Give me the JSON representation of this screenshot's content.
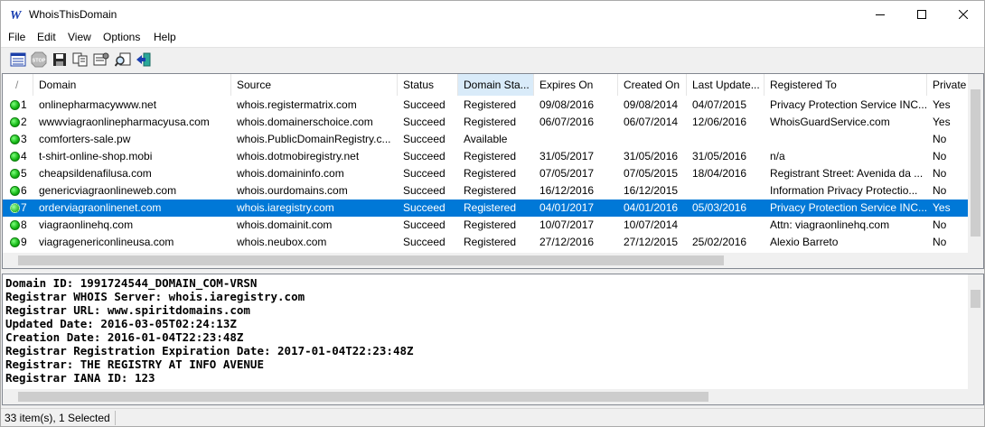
{
  "window": {
    "title": "WhoisThisDomain"
  },
  "menu": [
    {
      "label": "File"
    },
    {
      "label": "Edit"
    },
    {
      "label": "View"
    },
    {
      "label": "Options"
    },
    {
      "label": "Help"
    }
  ],
  "toolbar": [
    {
      "icon": "properties-list-icon"
    },
    {
      "icon": "stop-icon",
      "label": "STOP"
    },
    {
      "icon": "save-icon"
    },
    {
      "icon": "copy-icon"
    },
    {
      "icon": "html-report-icon"
    },
    {
      "icon": "search-icon"
    },
    {
      "icon": "exit-icon"
    }
  ],
  "columns": [
    {
      "label": "/"
    },
    {
      "label": "Domain"
    },
    {
      "label": "Source"
    },
    {
      "label": "Status"
    },
    {
      "label": "Domain Sta..."
    },
    {
      "label": "Expires On"
    },
    {
      "label": "Created On"
    },
    {
      "label": "Last Update..."
    },
    {
      "label": "Registered To"
    },
    {
      "label": "Private I"
    }
  ],
  "rows": [
    {
      "num": "1",
      "domain": "onlinepharmacywww.net",
      "source": "whois.registermatrix.com",
      "status": "Succeed",
      "domain_status": "Registered",
      "expires": "09/08/2016",
      "created": "09/08/2014",
      "updated": "04/07/2015",
      "registered_to": "Privacy Protection Service INC...",
      "private": "Yes"
    },
    {
      "num": "2",
      "domain": "wwwviagraonlinepharmacyusa.com",
      "source": "whois.domainerschoice.com",
      "status": "Succeed",
      "domain_status": "Registered",
      "expires": "06/07/2016",
      "created": "06/07/2014",
      "updated": "12/06/2016",
      "registered_to": "WhoisGuardService.com",
      "private": "Yes"
    },
    {
      "num": "3",
      "domain": "comforters-sale.pw",
      "source": "whois.PublicDomainRegistry.c...",
      "status": "Succeed",
      "domain_status": "Available",
      "expires": "",
      "created": "",
      "updated": "",
      "registered_to": "",
      "private": "No"
    },
    {
      "num": "4",
      "domain": "t-shirt-online-shop.mobi",
      "source": "whois.dotmobiregistry.net",
      "status": "Succeed",
      "domain_status": "Registered",
      "expires": "31/05/2017",
      "created": "31/05/2016",
      "updated": "31/05/2016",
      "registered_to": "n/a",
      "private": "No"
    },
    {
      "num": "5",
      "domain": "cheapsildenafilusa.com",
      "source": "whois.domaininfo.com",
      "status": "Succeed",
      "domain_status": "Registered",
      "expires": "07/05/2017",
      "created": "07/05/2015",
      "updated": "18/04/2016",
      "registered_to": "Registrant Street: Avenida da ...",
      "private": "No"
    },
    {
      "num": "6",
      "domain": "genericviagraonlineweb.com",
      "source": "whois.ourdomains.com",
      "status": "Succeed",
      "domain_status": "Registered",
      "expires": "16/12/2016",
      "created": "16/12/2015",
      "updated": "",
      "registered_to": "Information Privacy Protectio...",
      "private": "No"
    },
    {
      "num": "7",
      "domain": "orderviagraonlinenet.com",
      "source": "whois.iaregistry.com",
      "status": "Succeed",
      "domain_status": "Registered",
      "expires": "04/01/2017",
      "created": "04/01/2016",
      "updated": "05/03/2016",
      "registered_to": "Privacy Protection Service INC...",
      "private": "Yes",
      "selected": true
    },
    {
      "num": "8",
      "domain": "viagraonlinehq.com",
      "source": "whois.domainit.com",
      "status": "Succeed",
      "domain_status": "Registered",
      "expires": "10/07/2017",
      "created": "10/07/2014",
      "updated": "",
      "registered_to": "Attn: viagraonlinehq.com",
      "private": "No"
    },
    {
      "num": "9",
      "domain": "viagragenericonlineusa.com",
      "source": "whois.neubox.com",
      "status": "Succeed",
      "domain_status": "Registered",
      "expires": "27/12/2016",
      "created": "27/12/2015",
      "updated": "25/02/2016",
      "registered_to": "Alexio Barreto",
      "private": "No"
    }
  ],
  "details": [
    "Domain ID: 1991724544_DOMAIN_COM-VRSN",
    "Registrar WHOIS Server: whois.iaregistry.com",
    "Registrar URL: www.spiritdomains.com",
    "Updated Date: 2016-03-05T02:24:13Z",
    "Creation Date: 2016-01-04T22:23:48Z",
    "Registrar Registration Expiration Date: 2017-01-04T22:23:48Z",
    "Registrar: THE REGISTRY AT INFO AVENUE",
    "Registrar IANA ID: 123"
  ],
  "status_bar": {
    "text": "33 item(s), 1 Selected"
  },
  "colors": {
    "selection": "#0078d7",
    "sorted_header": "#d9ebf9",
    "status_ok": "#13b613"
  }
}
